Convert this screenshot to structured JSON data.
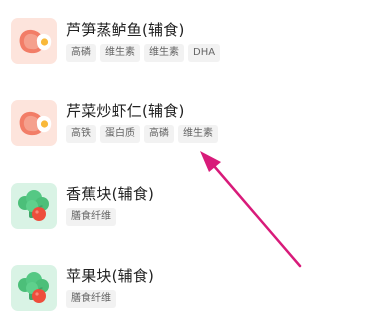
{
  "items": [
    {
      "name": "芦笋蒸鲈鱼(辅食)",
      "icon": "meat-egg-icon",
      "tags": [
        "高磷",
        "维生素",
        "维生素",
        "DHA"
      ]
    },
    {
      "name": "芹菜炒虾仁(辅食)",
      "icon": "meat-egg-icon",
      "tags": [
        "高铁",
        "蛋白质",
        "高磷",
        "维生素"
      ]
    },
    {
      "name": "香蕉块(辅食)",
      "icon": "vegetable-fruit-icon",
      "tags": [
        "膳食纤维"
      ]
    },
    {
      "name": "苹果块(辅食)",
      "icon": "vegetable-fruit-icon",
      "tags": [
        "膳食纤维"
      ]
    }
  ],
  "colors": {
    "meat_bg": "#fde4dc",
    "veg_bg": "#d9f3e5",
    "arrow": "#d81b7a"
  }
}
